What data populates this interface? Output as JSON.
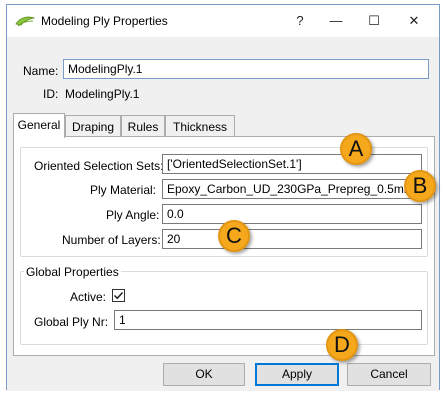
{
  "window": {
    "title": "Modeling Ply Properties",
    "help_label": "?",
    "minimize_label": "—",
    "maximize_label": "☐",
    "close_label": "✕"
  },
  "header": {
    "name_label": "Name:",
    "name_value": "ModelingPly.1",
    "id_label": "ID:",
    "id_value": "ModelingPly.1"
  },
  "tabs": [
    {
      "label": "General",
      "active": true
    },
    {
      "label": "Draping",
      "active": false
    },
    {
      "label": "Rules",
      "active": false
    },
    {
      "label": "Thickness",
      "active": false
    }
  ],
  "general": {
    "oss_label": "Oriented Selection Sets:",
    "oss_value": "['OrientedSelectionSet.1']",
    "material_label": "Ply Material:",
    "material_value": "Epoxy_Carbon_UD_230GPa_Prepreg_0.5mm",
    "angle_label": "Ply Angle:",
    "angle_value": "0.0",
    "layers_label": "Number of Layers:",
    "layers_value": "20"
  },
  "global_properties": {
    "title": "Global Properties",
    "active_label": "Active:",
    "active_checked": true,
    "ply_nr_label": "Global Ply Nr:",
    "ply_nr_value": "1"
  },
  "buttons": {
    "ok": "OK",
    "apply": "Apply",
    "cancel": "Cancel"
  },
  "callouts": {
    "a": "A",
    "b": "B",
    "c": "C",
    "d": "D"
  },
  "colors": {
    "callout_fill": "#f5a81c",
    "focus_border": "#0078d7"
  }
}
